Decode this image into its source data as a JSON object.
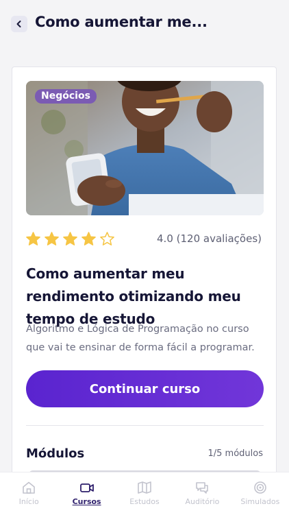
{
  "header": {
    "title": "Como aumentar me...",
    "back_icon": "chevron-left-icon"
  },
  "course": {
    "category": "Negócios",
    "rating": 4.0,
    "rating_text": "4.0 (120 avaliações)",
    "stars": {
      "filled": 4,
      "total": 5,
      "color": "#f6c544"
    },
    "title": "Como aumentar meu rendimento otimizando meu tempo de estudo",
    "description": "Algoritmo e Lógica de Programação no curso que vai te ensinar de forma fácil a programar.",
    "cta_label": "Continuar curso"
  },
  "modules": {
    "title": "Módulos",
    "count_text": "1/5 módulos"
  },
  "tabbar": {
    "items": [
      {
        "label": "Início",
        "icon": "home-icon",
        "active": false
      },
      {
        "label": "Cursos",
        "icon": "video-camera-icon",
        "active": true
      },
      {
        "label": "Estudos",
        "icon": "map-icon",
        "active": false
      },
      {
        "label": "Auditório",
        "icon": "chat-icon",
        "active": false
      },
      {
        "label": "Simulados",
        "icon": "target-icon",
        "active": false
      }
    ]
  },
  "colors": {
    "accent": "#5a24cf",
    "badge": "#7b5bb3",
    "active_tab": "#2d1e6b",
    "inactive_tab": "#c2c3cd"
  }
}
